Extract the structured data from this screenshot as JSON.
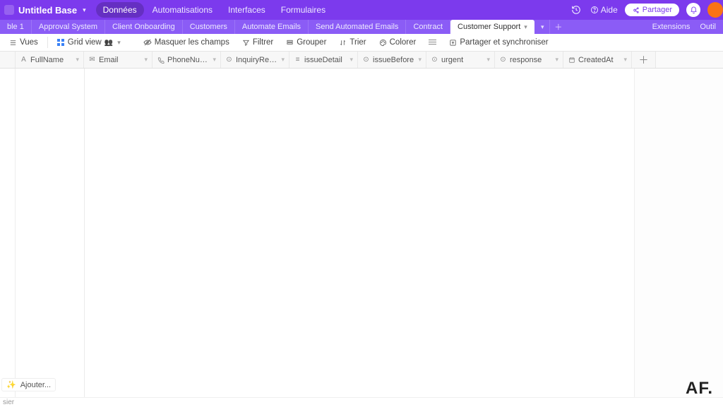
{
  "header": {
    "base_title": "Untitled Base",
    "nav": [
      "Données",
      "Automatisations",
      "Interfaces",
      "Formulaires"
    ],
    "nav_active_index": 0,
    "help_label": "Aide",
    "share_label": "Partager"
  },
  "tabs": {
    "items": [
      "ble 1",
      "Approval System",
      "Client Onboarding",
      "Customers",
      "Automate Emails",
      "Send Automated Emails",
      "Contract",
      "Customer Support"
    ],
    "active_index": 7,
    "right": {
      "extensions": "Extensions",
      "tools": "Outil"
    }
  },
  "toolbar": {
    "views_label": "Vues",
    "grid_view_label": "Grid view",
    "hide_fields": "Masquer les champs",
    "filter": "Filtrer",
    "group": "Grouper",
    "sort": "Trier",
    "color": "Colorer",
    "share_sync": "Partager et synchroniser"
  },
  "columns": [
    {
      "name": "FullName",
      "type_icon": "text"
    },
    {
      "name": "Email",
      "type_icon": "email"
    },
    {
      "name": "PhoneNumber",
      "type_icon": "phone"
    },
    {
      "name": "InquiryReason",
      "type_icon": "select"
    },
    {
      "name": "issueDetail",
      "type_icon": "longtext"
    },
    {
      "name": "issueBefore",
      "type_icon": "select"
    },
    {
      "name": "urgent",
      "type_icon": "select"
    },
    {
      "name": "response",
      "type_icon": "select"
    },
    {
      "name": "CreatedAt",
      "type_icon": "date"
    }
  ],
  "footer": {
    "add_label": "Ajouter...",
    "summary_label": "sier"
  },
  "watermark": "AF."
}
